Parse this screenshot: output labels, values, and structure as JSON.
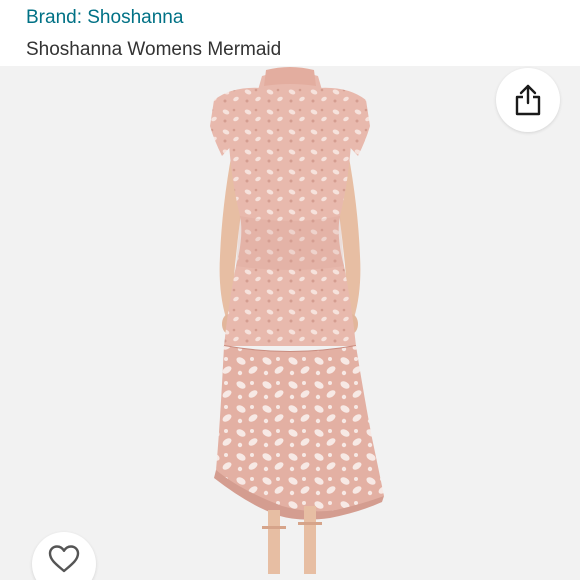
{
  "header": {
    "brand_link": "Brand: Shoshanna",
    "title": "Shoshanna Womens Mermaid"
  },
  "product_image": {
    "alt": "Shoshanna Womens Mermaid"
  },
  "actions": {
    "share_icon": "share-icon",
    "favorite_icon": "heart-outline-icon"
  },
  "colors": {
    "link": "#007185",
    "title_text": "#333333",
    "image_background": "#f2f2f2",
    "dress_pink": "#e8b9ad"
  }
}
